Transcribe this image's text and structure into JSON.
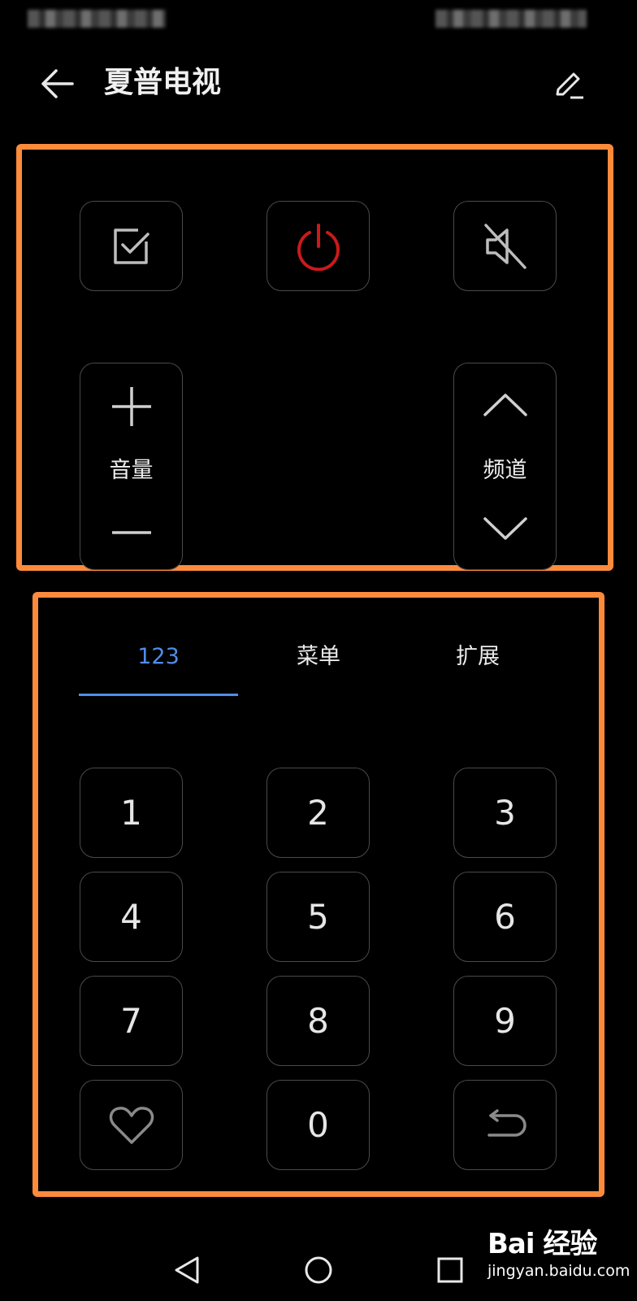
{
  "header": {
    "title": "夏普电视"
  },
  "controls": {
    "volume_label": "音量",
    "channel_label": "频道"
  },
  "keypad": {
    "tabs": [
      "123",
      "菜单",
      "扩展"
    ],
    "active_tab": "123",
    "digits": [
      "1",
      "2",
      "3",
      "4",
      "5",
      "6",
      "7",
      "8",
      "9",
      "0"
    ]
  },
  "colors": {
    "accent": "#4f8ee8",
    "power": "#cc1a1a",
    "highlight": "#fd8b3c",
    "background": "#000000"
  },
  "watermark": {
    "brand": "Bai 经验",
    "site": "jingyan.baidu.com"
  }
}
